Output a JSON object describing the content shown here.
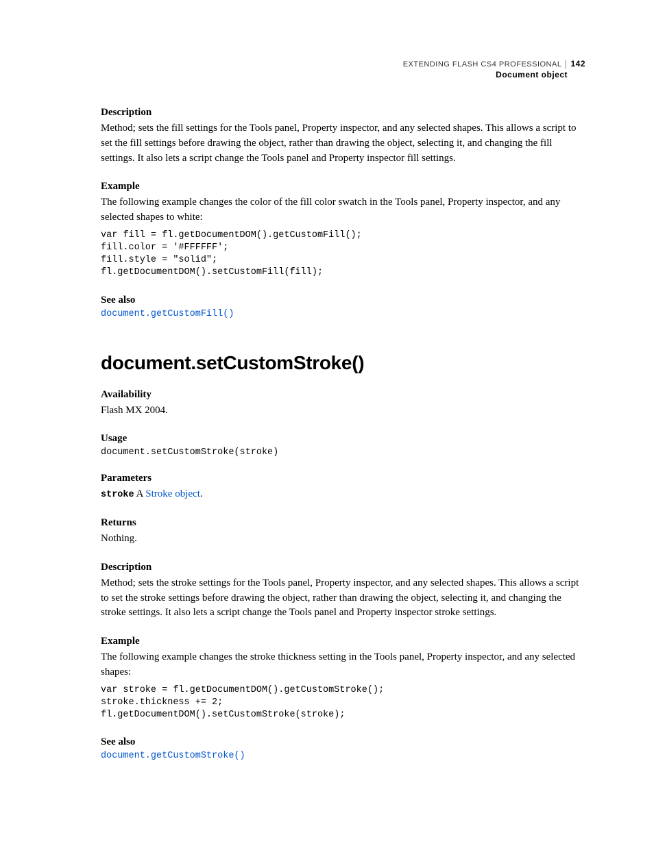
{
  "header": {
    "title": "EXTENDING FLASH CS4 PROFESSIONAL",
    "page_number": "142",
    "subtitle": "Document object"
  },
  "s1": {
    "desc_h": "Description",
    "desc_t": "Method; sets the fill settings for the Tools panel, Property inspector, and any selected shapes. This allows a script to set the fill settings before drawing the object, rather than drawing the object, selecting it, and changing the fill settings. It also lets a script change the Tools panel and Property inspector fill settings.",
    "ex_h": "Example",
    "ex_t": "The following example changes the color of the fill color swatch in the Tools panel, Property inspector, and any selected shapes to white:",
    "ex_code": "var fill = fl.getDocumentDOM().getCustomFill();\nfill.color = '#FFFFFF';\nfill.style = \"solid\";\nfl.getDocumentDOM().setCustomFill(fill);",
    "see_h": "See also",
    "see_link": "document.getCustomFill()"
  },
  "s2": {
    "title": "document.setCustomStroke()",
    "avail_h": "Availability",
    "avail_t": "Flash MX 2004.",
    "usage_h": "Usage",
    "usage_t": "document.setCustomStroke(stroke)",
    "param_h": "Parameters",
    "param_name": "stroke",
    "param_pre": "  A ",
    "param_link": "Stroke object",
    "param_post": ".",
    "ret_h": "Returns",
    "ret_t": "Nothing.",
    "desc_h": "Description",
    "desc_t": "Method; sets the stroke settings for the Tools panel, Property inspector, and any selected shapes. This allows a script to set the stroke settings before drawing the object, rather than drawing the object, selecting it, and changing the stroke settings. It also lets a script change the Tools panel and Property inspector stroke settings.",
    "ex_h": "Example",
    "ex_t": "The following example changes the stroke thickness setting in the Tools panel, Property inspector, and any selected shapes:",
    "ex_code": "var stroke = fl.getDocumentDOM().getCustomStroke();\nstroke.thickness += 2;\nfl.getDocumentDOM().setCustomStroke(stroke);",
    "see_h": "See also",
    "see_link": "document.getCustomStroke()"
  }
}
